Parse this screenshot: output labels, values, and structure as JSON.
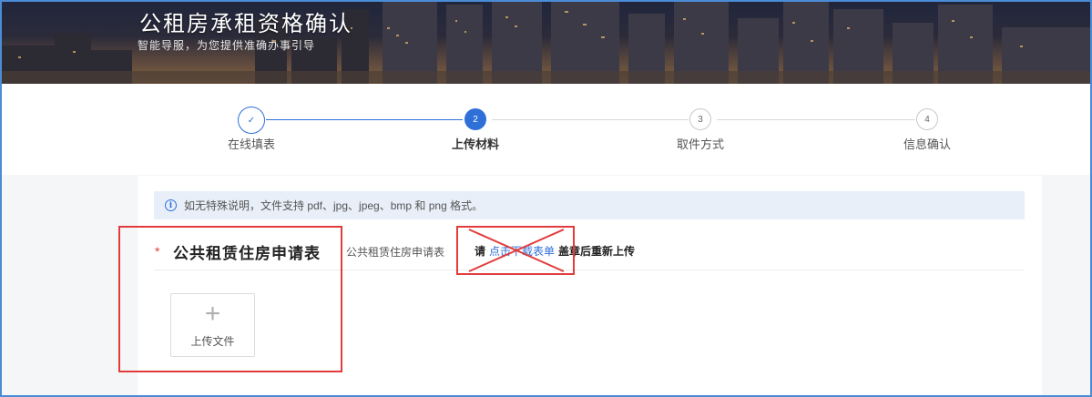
{
  "banner": {
    "title": "公租房承租资格确认",
    "subtitle": "智能导服，为您提供准确办事引导"
  },
  "steps": [
    {
      "number": "✓",
      "label": "在线填表",
      "state": "done"
    },
    {
      "number": "2",
      "label": "上传材料",
      "state": "active"
    },
    {
      "number": "3",
      "label": "取件方式",
      "state": "pending"
    },
    {
      "number": "4",
      "label": "信息确认",
      "state": "pending"
    }
  ],
  "notice": {
    "icon": "info-icon",
    "text": "如无特殊说明，文件支持 pdf、jpg、jpeg、bmp 和 png 格式。"
  },
  "form_item": {
    "required_mark": "*",
    "title": "公共租赁住房申请表",
    "material_name": "公共租赁住房申请表",
    "hint_prefix": "请",
    "hint_link": "点击下载表单",
    "hint_suffix": "盖章后重新上传"
  },
  "upload": {
    "icon": "plus-icon",
    "label": "上传文件"
  },
  "colors": {
    "accent": "#2f6fd8",
    "annotation_red": "#e23b3b",
    "required": "#e4393c"
  }
}
